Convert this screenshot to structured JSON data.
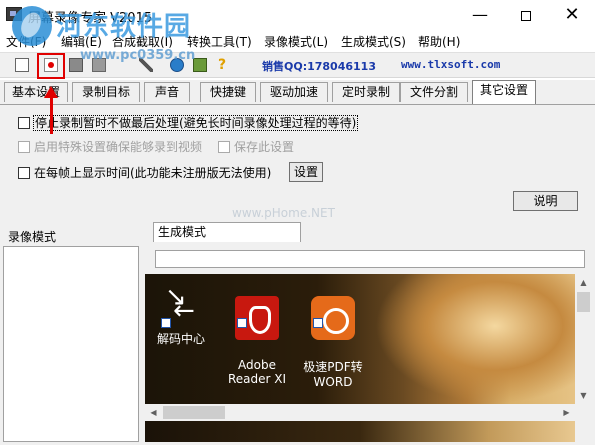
{
  "window": {
    "title": "屏幕录像专家 V2015",
    "minimize_glyph": "—",
    "close_glyph": "✕"
  },
  "watermark": {
    "title": "河东软件园",
    "url": "www.pc0359.cn",
    "center_text": "www.pHome.NET"
  },
  "menu": {
    "items": [
      {
        "label": "文件(F)"
      },
      {
        "label": "编辑(E)"
      },
      {
        "label": "合成截取(I)"
      },
      {
        "label": "转换工具(T)"
      },
      {
        "label": "录像模式(L)"
      },
      {
        "label": "生成模式(S)"
      },
      {
        "label": "帮助(H)"
      }
    ]
  },
  "toolbar": {
    "icons": [
      "new-file-icon",
      "record-icon",
      "film-icon",
      "stop-icon",
      "wand-icon",
      "globe-icon",
      "picture-icon",
      "help-icon"
    ],
    "help_glyph": "?",
    "sales_qq": "销售QQ:178046113",
    "website": "www.tlxsoft.com"
  },
  "tabs": [
    {
      "label": "基本设置"
    },
    {
      "label": "录制目标"
    },
    {
      "label": "声音"
    },
    {
      "label": "快捷键"
    },
    {
      "label": "驱动加速"
    },
    {
      "label": "定时录制"
    },
    {
      "label": "文件分割"
    },
    {
      "label": "其它设置",
      "active": true
    }
  ],
  "settings": {
    "option_pause": "停止录制暂时不做最后处理(避免长时间录像处理过程的等待)",
    "option_special": "启用特殊设置确保能够录到视频",
    "option_save": "保存此设置",
    "option_timestamp": "在每帧上显示时间(此功能未注册版无法使用)",
    "settings_button": "设置",
    "help_button": "说明"
  },
  "lower": {
    "left_label": "录像模式",
    "right_tab": "生成模式",
    "progress": 0
  },
  "desktop_icons": [
    {
      "label": "解码中心"
    },
    {
      "label": "Adobe\nReader XI"
    },
    {
      "label": "极速PDF转\nWORD"
    }
  ],
  "colors": {
    "record_red": "#e00000",
    "link_blue": "#1a3aaa",
    "highlight_red": "#e00000"
  }
}
